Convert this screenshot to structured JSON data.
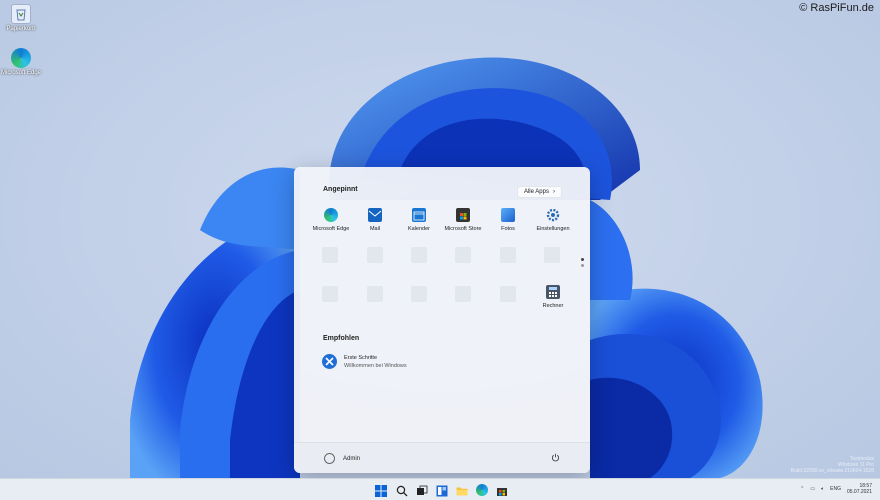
{
  "watermark": "© RasPiFun.de",
  "desktop": {
    "icons": [
      {
        "name": "recycle-bin",
        "label": "Papierkorb"
      },
      {
        "name": "edge",
        "label": "Microsoft Edge"
      }
    ]
  },
  "start_menu": {
    "pinned_title": "Angepinnt",
    "all_apps_label": "Alle Apps",
    "pinned_apps": [
      {
        "label": "Microsoft Edge",
        "color": "#1d8fd8"
      },
      {
        "label": "Mail",
        "color": "#1565c0"
      },
      {
        "label": "Kalender",
        "color": "#1976d2"
      },
      {
        "label": "Microsoft Store",
        "color": "#333"
      },
      {
        "label": "Fotos",
        "color": "#2f7fd6"
      },
      {
        "label": "Einstellungen",
        "color": "#2b6cb0"
      }
    ],
    "extra_app": {
      "label": "Rechner",
      "color": "#4a5568"
    },
    "recommended_title": "Empfohlen",
    "recommended": [
      {
        "title": "Erste Schritte",
        "subtitle": "Willkommen bei Windows"
      }
    ],
    "user": "Admin"
  },
  "taskbar": {
    "tray_text": "ENG",
    "clock_time": "18:57",
    "clock_date": "05.07.2021"
  },
  "activation": {
    "line1": "Testmodus",
    "line2": "Windows 11 Pro",
    "line3": "Build 22000.co_release.210604-1628"
  }
}
